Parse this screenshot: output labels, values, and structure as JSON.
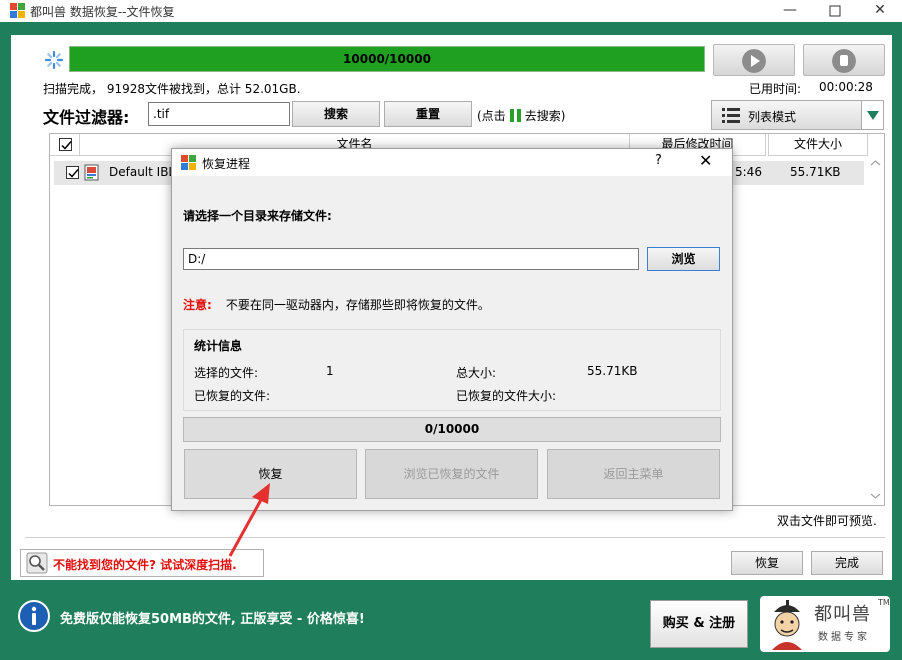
{
  "window": {
    "title": "都叫兽 数据恢复--文件恢复"
  },
  "progress": {
    "text": "10000/10000",
    "fraction": 1.0
  },
  "status": {
    "scan_result": "扫描完成， 91928文件被找到，总计 52.01GB.",
    "elapsed_label": "已用时间:",
    "elapsed_value": "00:00:28"
  },
  "filter": {
    "label": "文件过滤器:",
    "value": ".tif",
    "search_label": "搜索",
    "reset_label": "重置",
    "hint_before": "(点击",
    "hint_after": "去搜索)",
    "view_mode": "列表模式"
  },
  "table": {
    "columns": [
      "文件名",
      "最后修改时间",
      "文件大小"
    ],
    "rows": [
      {
        "checked": true,
        "name": "Default IBL",
        "time": "5:46",
        "size": "55.71KB"
      }
    ]
  },
  "preview_hint": "双击文件即可预览.",
  "deep_scan": "不能找到您的文件? 试试深度扫描.",
  "footer_buttons": {
    "recover": "恢复",
    "finish": "完成"
  },
  "ad": {
    "text": "免费版仅能恢复50MB的文件, 正版享受 - 价格惊喜!",
    "buy_label": "购买 & 注册",
    "brand": "都叫兽",
    "brand_sub": "数据专家",
    "tm": "TM"
  },
  "dialog": {
    "title": "恢复进程",
    "help": "?",
    "close": "✕",
    "prompt": "请选择一个目录来存储文件:",
    "path": "D:/",
    "browse_label": "浏览",
    "note_key": "注意:",
    "note_text": "不要在同一驱动器内，存储那些即将恢复的文件。",
    "stats": {
      "header": "统计信息",
      "selected_label": "选择的文件:",
      "selected_value": "1",
      "total_size_label": "总大小:",
      "total_size_value": "55.71KB",
      "recovered_label": "已恢复的文件:",
      "recovered_size_label": "已恢复的文件大小:"
    },
    "progress_text": "0/10000",
    "buttons": {
      "recover": "恢复",
      "browse_recovered": "浏览已恢复的文件",
      "main_menu": "返回主菜单"
    }
  },
  "colors": {
    "frame": "#1f7f5c",
    "progress": "#20a020",
    "warning": "#e0100c",
    "arrow": "#e53030"
  },
  "icons": [
    "app-icon",
    "spinner-icon",
    "play-icon",
    "stop-icon",
    "pause-icon",
    "list-icon",
    "file-icon",
    "magnifier-icon",
    "info-icon",
    "mascot-icon",
    "chevron-down-icon",
    "minimize-icon",
    "maximize-icon",
    "close-icon"
  ]
}
